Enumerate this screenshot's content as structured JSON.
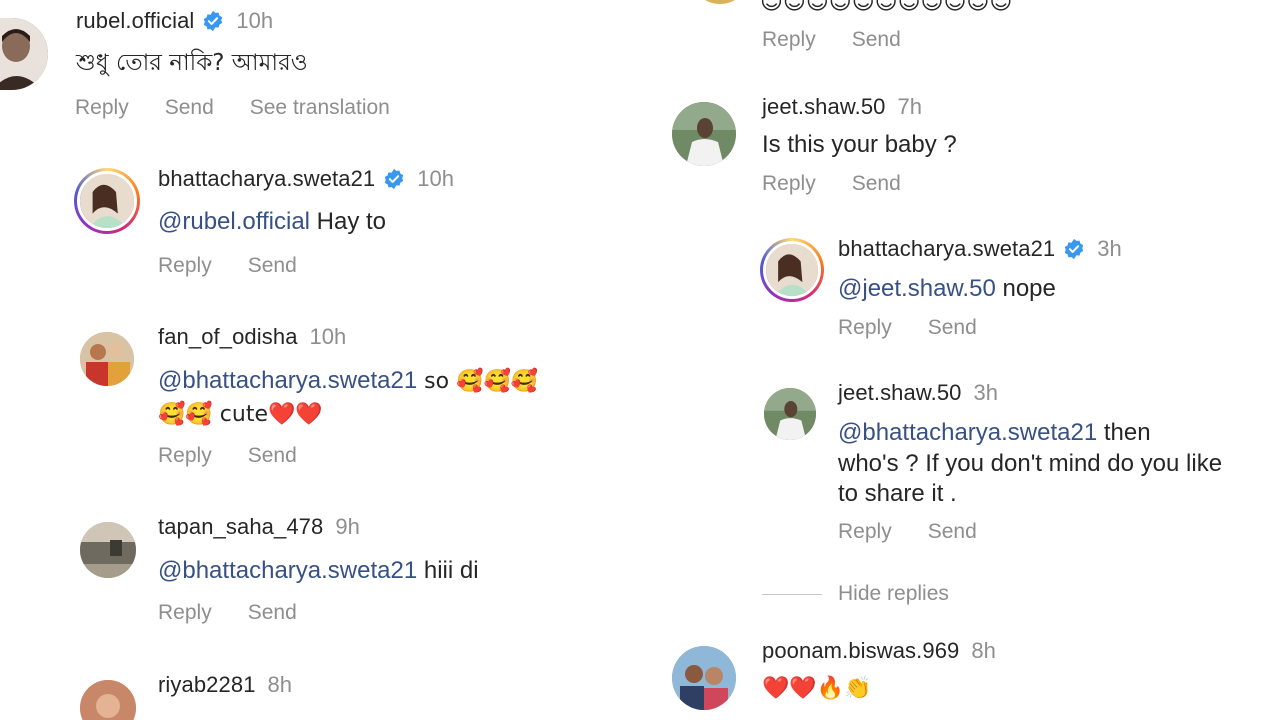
{
  "left": {
    "c1": {
      "username": "rubel.official",
      "verified": true,
      "time": "10h",
      "text": "শুধু তোর নাকি? আমারও",
      "actions": [
        "Reply",
        "Send",
        "See translation"
      ]
    },
    "c2": {
      "username": "bhattacharya.sweta21",
      "verified": true,
      "time": "10h",
      "mention": "@rubel.official",
      "text": " Hay to",
      "actions": [
        "Reply",
        "Send"
      ]
    },
    "c3": {
      "username": "fan_of_odisha",
      "time": "10h",
      "mention": "@bhattacharya.sweta21",
      "text_line1": " so 🥰🥰🥰",
      "text_line2": "🥰🥰 cute❤️❤️",
      "actions": [
        "Reply",
        "Send"
      ]
    },
    "c4": {
      "username": "tapan_saha_478",
      "time": "9h",
      "mention": "@bhattacharya.sweta21",
      "text": " hiii di",
      "actions": [
        "Reply",
        "Send"
      ]
    },
    "c5": {
      "username": "riyab2281",
      "time": "8h"
    }
  },
  "right": {
    "top_emojis": "😌😌😌😌😌😌😌😌😌😌😌",
    "top_actions": [
      "Reply",
      "Send"
    ],
    "c1": {
      "username": "jeet.shaw.50",
      "time": "7h",
      "text": "Is this your baby ?",
      "actions": [
        "Reply",
        "Send"
      ]
    },
    "c2": {
      "username": "bhattacharya.sweta21",
      "verified": true,
      "time": "3h",
      "mention": "@jeet.shaw.50",
      "text": " nope",
      "actions": [
        "Reply",
        "Send"
      ]
    },
    "c3": {
      "username": "jeet.shaw.50",
      "time": "3h",
      "mention": "@bhattacharya.sweta21",
      "text_line1": "  then",
      "text_line2": "who's ? If you don't mind do you like",
      "text_line3": "to share it .",
      "actions": [
        "Reply",
        "Send"
      ]
    },
    "hide_replies": "Hide replies",
    "c4": {
      "username": "poonam.biswas.969",
      "time": "8h",
      "text": "❤️❤️🔥👏"
    }
  },
  "colors": {
    "mention": "#385185",
    "verified": "#3897f0",
    "muted": "#8e8e8e",
    "text": "#262626"
  }
}
